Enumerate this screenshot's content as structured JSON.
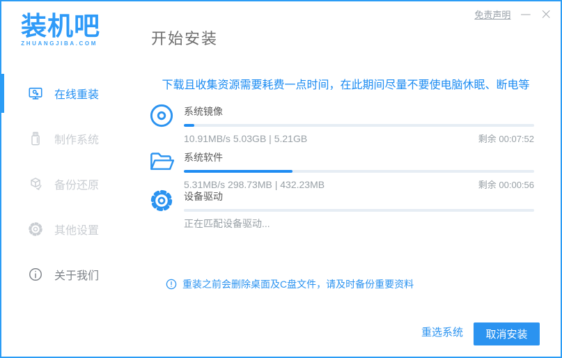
{
  "window": {
    "disclaimer_link": "免责声明",
    "minimize_label": "—",
    "close_label": "×"
  },
  "brand": {
    "logo_text": "装机吧",
    "logo_domain": "ZHUANGJIBA.COM"
  },
  "header": {
    "title": "开始安装"
  },
  "sidebar": {
    "items": [
      {
        "label": "在线重装",
        "icon": "monitor-reinstall-icon",
        "active": true
      },
      {
        "label": "制作系统",
        "icon": "usb-drive-icon",
        "active": false
      },
      {
        "label": "备份还原",
        "icon": "backup-restore-icon",
        "active": false
      },
      {
        "label": "其他设置",
        "icon": "settings-gear-icon",
        "active": false
      },
      {
        "label": "关于我们",
        "icon": "info-circle-icon",
        "active": false
      }
    ]
  },
  "main": {
    "notice": "下载且收集资源需要耗费一点时间，在此期间尽量不要使电脑休眠、断电等",
    "tasks": [
      {
        "name": "系统镜像",
        "icon": "disc-icon",
        "progress_percent": 3,
        "stats": "10.91MB/s 5.03GB | 5.21GB",
        "remaining": "剩余 00:07:52"
      },
      {
        "name": "系统软件",
        "icon": "folder-icon",
        "progress_percent": 31,
        "stats": "5.31MB/s 298.73MB | 432.23MB",
        "remaining": "剩余 00:00:56"
      },
      {
        "name": "设备驱动",
        "icon": "gear-icon",
        "progress_percent": 0,
        "stats": "正在匹配设备驱动...",
        "remaining": ""
      }
    ],
    "warning_note": "重装之前会删除桌面及C盘文件，请及时备份重要资料"
  },
  "footer": {
    "reselect_label": "重选系统",
    "cancel_label": "取消安装"
  },
  "colors": {
    "accent": "#2b93f0",
    "window_border": "#2b9cf5",
    "notice_text": "#1b8bf2",
    "progress_fill": "#1e8cf2",
    "progress_track": "#e6edf4",
    "muted_text": "#98a0a6",
    "label_text": "#595959",
    "sidebar_inactive": "#c9cdd2"
  }
}
